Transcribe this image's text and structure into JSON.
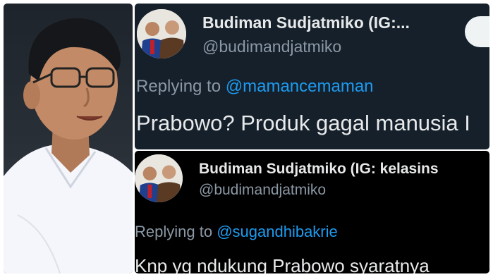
{
  "photo": {
    "subject": "man-smiling-portrait"
  },
  "tweets": [
    {
      "display_name": "Budiman Sudjatmiko (IG:...",
      "handle": "@budimandjatmiko",
      "reply_prefix": "Replying to",
      "reply_to": "@mamancemaman",
      "text": "Prabowo? Produk gagal manusia I"
    },
    {
      "display_name": "Budiman Sudjatmiko (IG: kelasins",
      "handle": "@budimandjatmiko",
      "reply_prefix": "Replying to",
      "reply_to": "@sugandhibakrie",
      "text": "Knp yg ndukung Prabowo syaratnya"
    }
  ],
  "colors": {
    "dim_bg": "#15202b",
    "black_bg": "#000000",
    "text_primary": "#e7e9ea",
    "text_secondary": "#8b98a5",
    "link_blue": "#1d9bf0"
  },
  "icons": [
    "avatar"
  ]
}
